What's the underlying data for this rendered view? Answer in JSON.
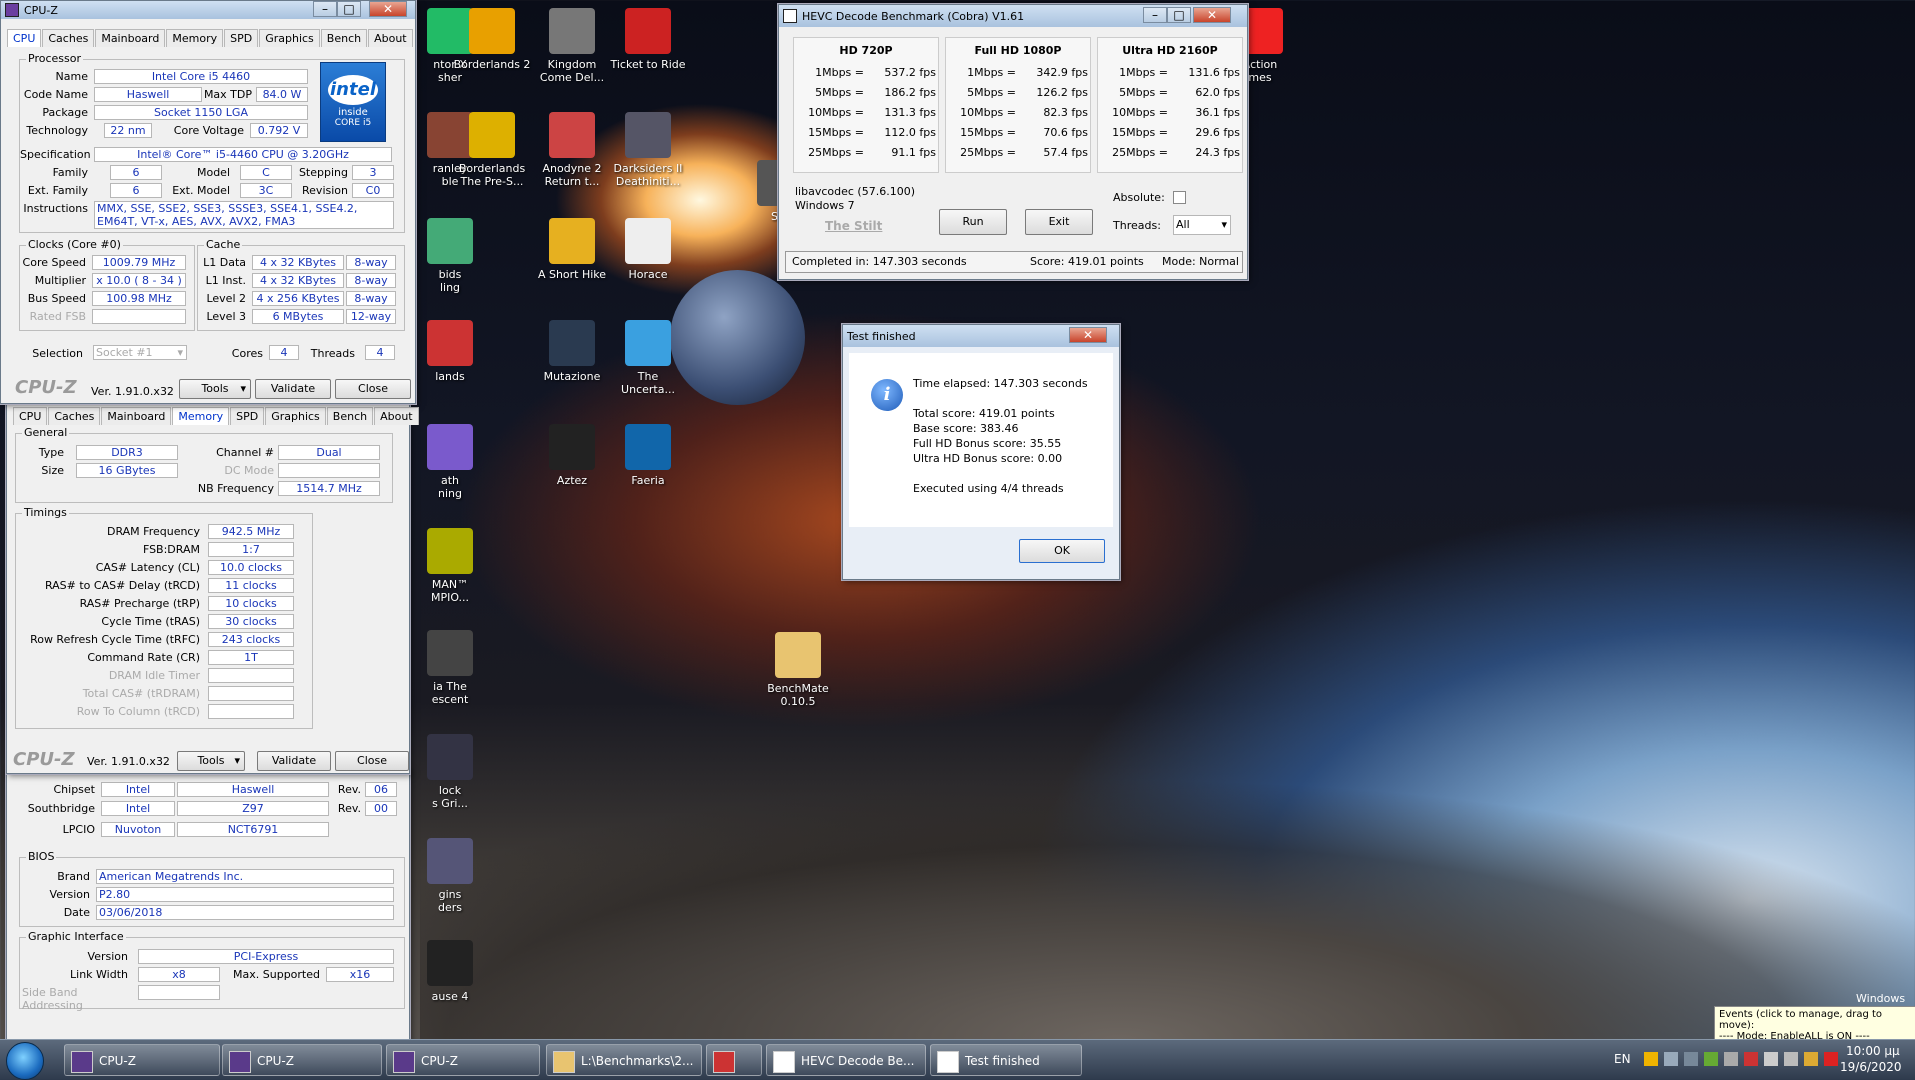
{
  "desktop_icons": [
    {
      "label": "ntor X\nsher"
    },
    {
      "label": "Borderlands 2"
    },
    {
      "label": "Kingdom\nCome Del..."
    },
    {
      "label": "Ticket to Ride"
    },
    {
      "label": "Action\nmes"
    },
    {
      "label": "ranley\nble"
    },
    {
      "label": "Borderlands\nThe Pre-S..."
    },
    {
      "label": "Anodyne 2\nReturn t..."
    },
    {
      "label": "Darksiders II\nDeathiniti..."
    },
    {
      "label": "Ste"
    },
    {
      "label": "bids\nling"
    },
    {
      "label": "A Short Hike"
    },
    {
      "label": "Horace"
    },
    {
      "label": "lands"
    },
    {
      "label": "Mutazione"
    },
    {
      "label": "The\nUncerta..."
    },
    {
      "label": "ath\nning"
    },
    {
      "label": "Aztez"
    },
    {
      "label": "Faeria"
    },
    {
      "label": "MAN™\nMPIO..."
    },
    {
      "label": "ia The\nescent"
    },
    {
      "label": "BenchMate\n0.10.5"
    },
    {
      "label": "lock\ns Gri..."
    },
    {
      "label": "gins\nders"
    },
    {
      "label": "ause 4"
    }
  ],
  "cpuz_top": {
    "title": "CPU-Z",
    "tabs": [
      "CPU",
      "Caches",
      "Mainboard",
      "Memory",
      "SPD",
      "Graphics",
      "Bench",
      "About"
    ],
    "processor_group": "Processor",
    "name_label": "Name",
    "name": "Intel Core i5 4460",
    "codename_label": "Code Name",
    "codename": "Haswell",
    "maxtdp_label": "Max TDP",
    "maxtdp": "84.0 W",
    "package_label": "Package",
    "package": "Socket 1150 LGA",
    "technology_label": "Technology",
    "technology": "22 nm",
    "corevoltage_label": "Core Voltage",
    "corevoltage": "0.792 V",
    "spec_label": "Specification",
    "spec": "Intel® Core™ i5-4460  CPU @ 3.20GHz",
    "family_label": "Family",
    "family": "6",
    "model_label": "Model",
    "model": "C",
    "stepping_label": "Stepping",
    "stepping": "3",
    "extfamily_label": "Ext. Family",
    "extfamily": "6",
    "extmodel_label": "Ext. Model",
    "extmodel": "3C",
    "revision_label": "Revision",
    "revision": "C0",
    "instr_label": "Instructions",
    "instr": "MMX, SSE, SSE2, SSE3, SSSE3, SSE4.1, SSE4.2, EM64T, VT-x, AES, AVX, AVX2, FMA3",
    "clocks_group": "Clocks (Core #0)",
    "corespeed_label": "Core Speed",
    "corespeed": "1009.79 MHz",
    "multiplier_label": "Multiplier",
    "multiplier": "x 10.0 ( 8 - 34 )",
    "busspeed_label": "Bus Speed",
    "busspeed": "100.98 MHz",
    "ratedfsb_label": "Rated FSB",
    "cache_group": "Cache",
    "l1d_label": "L1 Data",
    "l1d": "4 x 32 KBytes",
    "l1d_way": "8-way",
    "l1i_label": "L1 Inst.",
    "l1i": "4 x 32 KBytes",
    "l1i_way": "8-way",
    "l2_label": "Level 2",
    "l2": "4 x 256 KBytes",
    "l2_way": "8-way",
    "l3_label": "Level 3",
    "l3": "6 MBytes",
    "l3_way": "12-way",
    "selection_label": "Selection",
    "selection": "Socket #1",
    "cores_label": "Cores",
    "cores": "4",
    "threads_label": "Threads",
    "threads": "4",
    "logo": "CPU-Z",
    "version": "Ver. 1.91.0.x32",
    "tools": "Tools",
    "validate": "Validate",
    "close": "Close",
    "intel_brand": "intel",
    "intel_inside": "inside",
    "intel_core": "CORE i5"
  },
  "cpuz_mem": {
    "tabs": [
      "CPU",
      "Caches",
      "Mainboard",
      "Memory",
      "SPD",
      "Graphics",
      "Bench",
      "About"
    ],
    "general_group": "General",
    "type_label": "Type",
    "type": "DDR3",
    "channel_label": "Channel #",
    "channel": "Dual",
    "size_label": "Size",
    "size": "16 GBytes",
    "dcmode_label": "DC Mode",
    "nbfreq_label": "NB Frequency",
    "nbfreq": "1514.7 MHz",
    "timings_group": "Timings",
    "rows": [
      {
        "label": "DRAM Frequency",
        "value": "942.5 MHz"
      },
      {
        "label": "FSB:DRAM",
        "value": "1:7"
      },
      {
        "label": "CAS# Latency (CL)",
        "value": "10.0 clocks"
      },
      {
        "label": "RAS# to CAS# Delay (tRCD)",
        "value": "11 clocks"
      },
      {
        "label": "RAS# Precharge (tRP)",
        "value": "10 clocks"
      },
      {
        "label": "Cycle Time (tRAS)",
        "value": "30 clocks"
      },
      {
        "label": "Row Refresh Cycle Time (tRFC)",
        "value": "243 clocks"
      },
      {
        "label": "Command Rate (CR)",
        "value": "1T"
      },
      {
        "label": "DRAM Idle Timer",
        "value": ""
      },
      {
        "label": "Total CAS# (tRDRAM)",
        "value": ""
      },
      {
        "label": "Row To Column (tRCD)",
        "value": ""
      }
    ],
    "logo": "CPU-Z",
    "version": "Ver. 1.91.0.x32",
    "tools": "Tools",
    "validate": "Validate",
    "close": "Close"
  },
  "cpuz_mb": {
    "chipset_label": "Chipset",
    "chipset_vendor": "Intel",
    "chipset": "Haswell",
    "chipset_rev_label": "Rev.",
    "chipset_rev": "06",
    "southbridge_label": "Southbridge",
    "sb_vendor": "Intel",
    "sb": "Z97",
    "sb_rev_label": "Rev.",
    "sb_rev": "00",
    "lpcio_label": "LPCIO",
    "lpcio_vendor": "Nuvoton",
    "lpcio": "NCT6791",
    "bios_group": "BIOS",
    "brand_label": "Brand",
    "brand": "American Megatrends Inc.",
    "version_label": "Version",
    "bios_version": "P2.80",
    "date_label": "Date",
    "date": "03/06/2018",
    "gi_group": "Graphic Interface",
    "gi_version_label": "Version",
    "gi_version": "PCI-Express",
    "linkwidth_label": "Link Width",
    "linkwidth": "x8",
    "maxsupported_label": "Max. Supported",
    "maxsupported": "x16",
    "sideband_label": "Side Band Addressing"
  },
  "hevc": {
    "title": "HEVC Decode Benchmark (Cobra) V1.61",
    "cols": [
      {
        "header": "HD 720P",
        "rows": [
          [
            "1Mbps =",
            "537.2 fps"
          ],
          [
            "5Mbps =",
            "186.2 fps"
          ],
          [
            "10Mbps =",
            "131.3 fps"
          ],
          [
            "15Mbps =",
            "112.0 fps"
          ],
          [
            "25Mbps =",
            "91.1 fps"
          ]
        ]
      },
      {
        "header": "Full HD 1080P",
        "rows": [
          [
            "1Mbps =",
            "342.9 fps"
          ],
          [
            "5Mbps =",
            "126.2 fps"
          ],
          [
            "10Mbps =",
            "82.3 fps"
          ],
          [
            "15Mbps =",
            "70.6 fps"
          ],
          [
            "25Mbps =",
            "57.4 fps"
          ]
        ]
      },
      {
        "header": "Ultra HD 2160P",
        "rows": [
          [
            "1Mbps =",
            "131.6 fps"
          ],
          [
            "5Mbps =",
            "62.0 fps"
          ],
          [
            "10Mbps =",
            "36.1 fps"
          ],
          [
            "15Mbps =",
            "29.6 fps"
          ],
          [
            "25Mbps =",
            "24.3 fps"
          ]
        ]
      }
    ],
    "libavcodec": "libavcodec (57.6.100)",
    "os": "Windows 7",
    "stilt": "The Stilt",
    "run": "Run",
    "exit": "Exit",
    "absolute_label": "Absolute:",
    "threads_label": "Threads:",
    "threads_value": "All",
    "completed": "Completed in: 147.303 seconds",
    "score": "Score: 419.01 points",
    "mode": "Mode: Normal"
  },
  "dialog": {
    "title": "Test finished",
    "elapsed": "Time elapsed: 147.303 seconds",
    "total": "Total score: 419.01 points",
    "base": "Base score: 383.46",
    "fullhd": "Full HD Bonus score: 35.55",
    "ultrahd": "Ultra HD Bonus score: 0.00",
    "threads": "Executed using 4/4 threads",
    "ok": "OK"
  },
  "taskbar": {
    "items": [
      "CPU-Z",
      "CPU-Z",
      "CPU-Z",
      "L:\\Benchmarks\\2...",
      "",
      "HEVC Decode Be...",
      "Test finished"
    ],
    "lang": "EN",
    "time": "10:00 µµ",
    "date": "19/6/2020"
  },
  "tooltip": {
    "line1": "Events (click to manage, drag to move):",
    "line2": "---- Mode: EnableALL is ON ----"
  },
  "watermark": "Windows 7"
}
